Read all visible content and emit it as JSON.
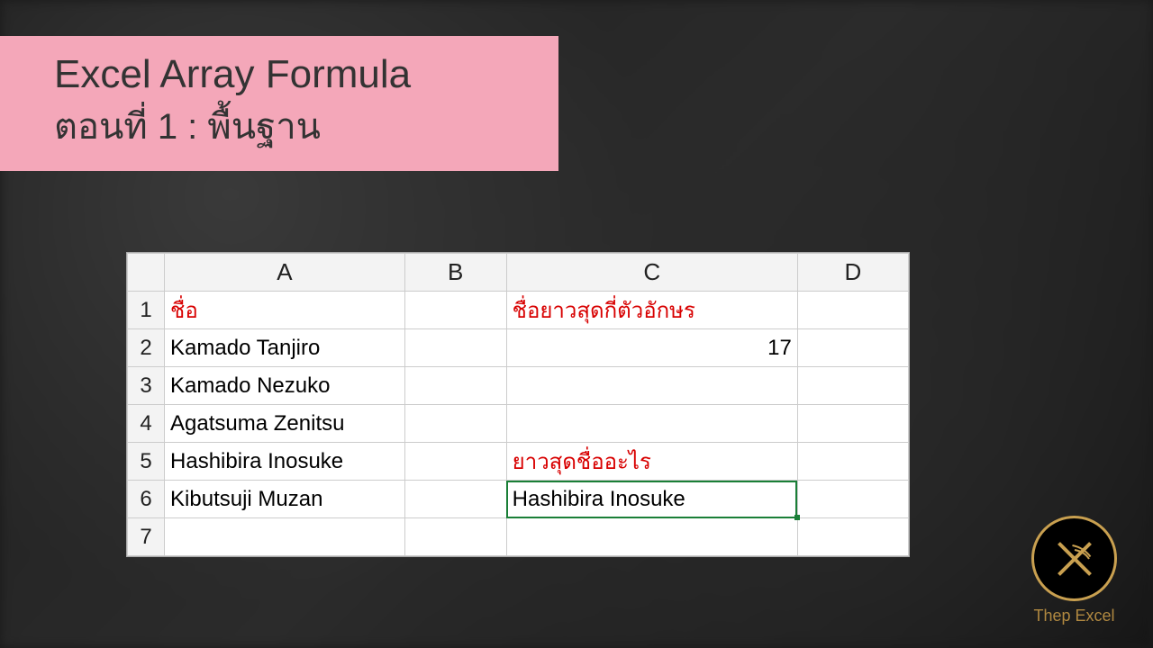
{
  "banner": {
    "line1": "Excel Array Formula",
    "line2": "ตอนที่ 1 : พื้นฐาน"
  },
  "sheet": {
    "columns": [
      "A",
      "B",
      "C",
      "D"
    ],
    "rows": [
      "1",
      "2",
      "3",
      "4",
      "5",
      "6",
      "7"
    ],
    "cells": {
      "A1": "ชื่อ",
      "C1": "ชื่อยาวสุดกี่ตัวอักษร",
      "A2": "Kamado Tanjiro",
      "C2": "17",
      "A3": "Kamado Nezuko",
      "A4": "Agatsuma Zenitsu",
      "A5": "Hashibira Inosuke",
      "C5": "ยาวสุดชื่ออะไร",
      "A6": "Kibutsuji Muzan",
      "C6": "Hashibira Inosuke"
    },
    "selected_cell": "C6"
  },
  "branding": {
    "label": "Thep Excel"
  }
}
